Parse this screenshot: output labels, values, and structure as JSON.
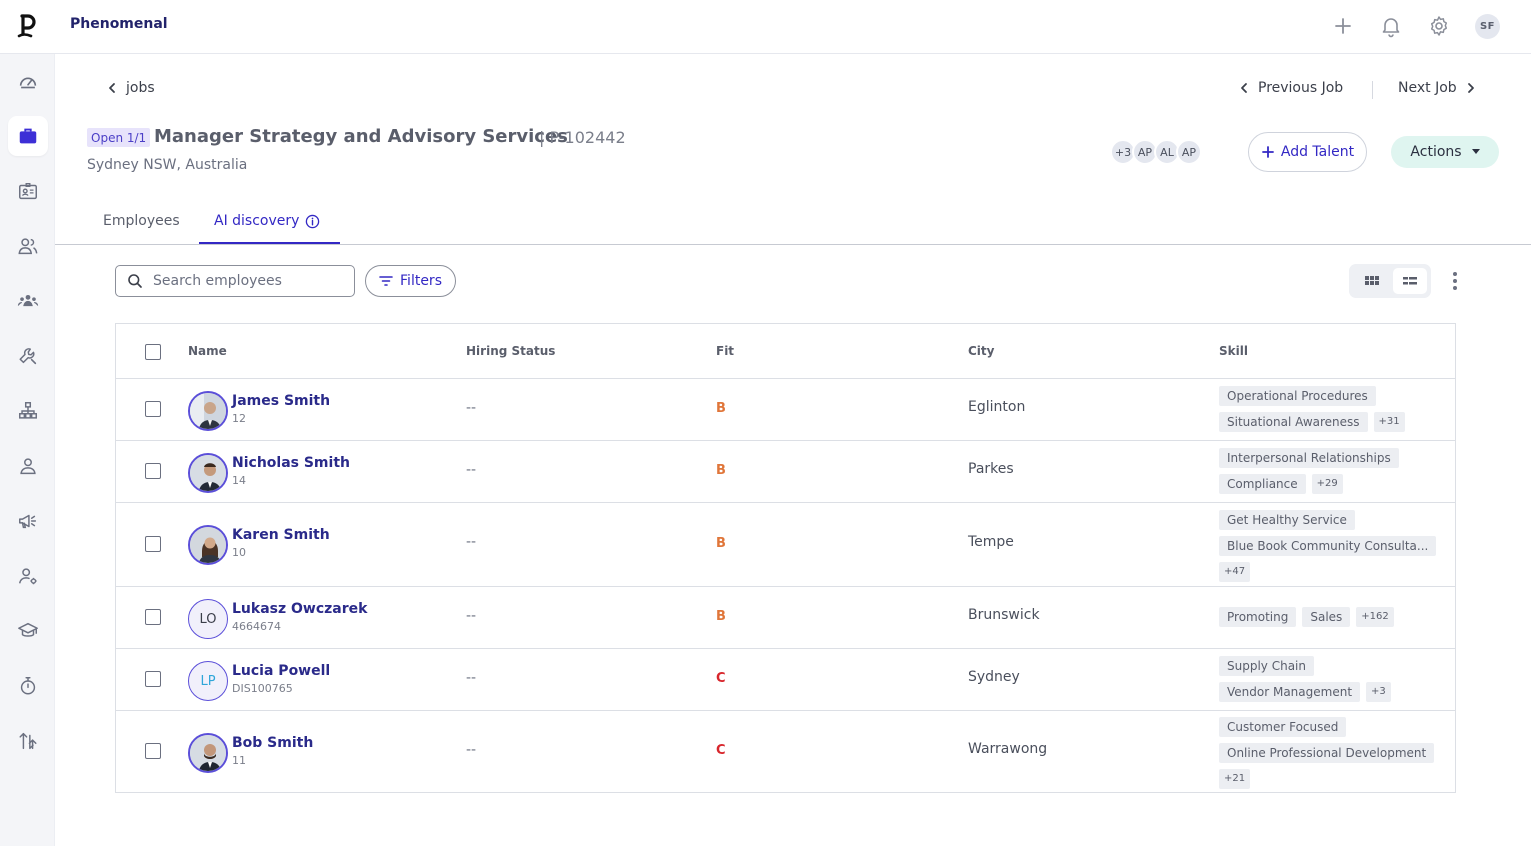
{
  "app": {
    "brand": "Phenomenal",
    "user_initials": "SF"
  },
  "nav": {
    "back_label": "jobs",
    "previous_label": "Previous Job",
    "next_label": "Next Job"
  },
  "job": {
    "status": "Open 1/1",
    "title": "Manager Strategy and Advisory Services",
    "id": "| P-102442",
    "location": "Sydney NSW, Australia",
    "team_more": "+3",
    "team": [
      "AP",
      "AL",
      "AP"
    ],
    "add_talent_label": "Add Talent",
    "actions_label": "Actions"
  },
  "tabs": [
    {
      "label": "Employees",
      "active": false
    },
    {
      "label": "AI discovery",
      "active": true
    }
  ],
  "toolbar": {
    "search_placeholder": "Search employees",
    "filters_label": "Filters"
  },
  "table": {
    "columns": [
      "Name",
      "Hiring Status",
      "Fit",
      "City",
      "Skill"
    ],
    "rows": [
      {
        "name": "James Smith",
        "id": "12",
        "status": "--",
        "fit": "B",
        "city": "Eglinton",
        "skills": [
          "Operational Procedures",
          "Situational Awareness"
        ],
        "more": "+31"
      },
      {
        "name": "Nicholas Smith",
        "id": "14",
        "status": "--",
        "fit": "B",
        "city": "Parkes",
        "skills": [
          "Interpersonal Relationships",
          "Compliance"
        ],
        "more": "+29"
      },
      {
        "name": "Karen Smith",
        "id": "10",
        "status": "--",
        "fit": "B",
        "city": "Tempe",
        "skills": [
          "Get Healthy Service",
          "Blue Book Community Consulta..."
        ],
        "more": "+47"
      },
      {
        "name": "Lukasz Owczarek",
        "id": "4664674",
        "initials": "LO",
        "status": "--",
        "fit": "B",
        "city": "Brunswick",
        "skills": [
          "Promoting",
          "Sales"
        ],
        "more": "+162"
      },
      {
        "name": "Lucia Powell",
        "id": "DIS100765",
        "initials": "LP",
        "status": "--",
        "fit": "C",
        "city": "Sydney",
        "skills": [
          "Supply Chain",
          "Vendor Management"
        ],
        "more": "+3"
      },
      {
        "name": "Bob Smith",
        "id": "11",
        "status": "--",
        "fit": "C",
        "city": "Warrawong",
        "skills": [
          "Customer Focused",
          "Online Professional Development"
        ],
        "more": "+21"
      }
    ]
  },
  "colors": {
    "accent": "#3328c4",
    "fit_b": "#e0763a",
    "fit_c": "#d8262c",
    "actions_bg": "#dff5f0"
  },
  "icons": {
    "sidebar": [
      "dashboard-icon",
      "briefcase-icon",
      "id-card-icon",
      "people-icon",
      "team-icon",
      "wrench-icon",
      "org-chart-icon",
      "person-icon",
      "megaphone-icon",
      "user-settings-icon",
      "graduation-cap-icon",
      "stopwatch-icon",
      "sort-arrows-icon"
    ],
    "top": [
      "plus-icon",
      "bell-icon",
      "gear-icon"
    ]
  }
}
